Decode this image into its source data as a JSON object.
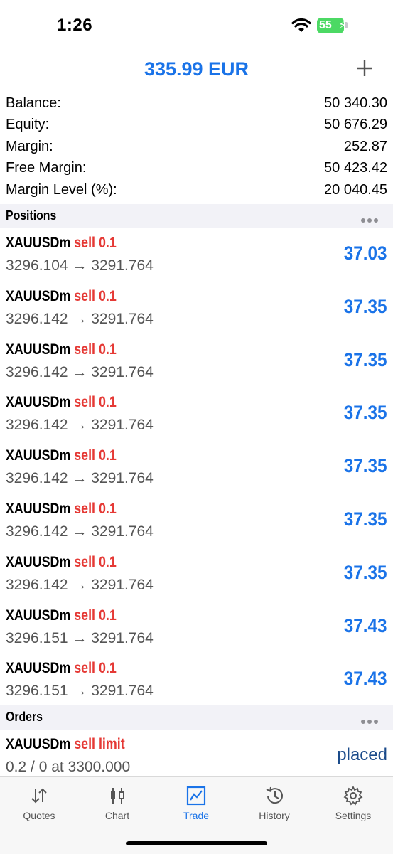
{
  "status_bar": {
    "time": "1:26",
    "battery": "55"
  },
  "header": {
    "title": "335.99 EUR"
  },
  "summary": [
    {
      "label": "Balance:",
      "value": "50 340.30"
    },
    {
      "label": "Equity:",
      "value": "50 676.29"
    },
    {
      "label": "Margin:",
      "value": "252.87"
    },
    {
      "label": "Free Margin:",
      "value": "50 423.42"
    },
    {
      "label": "Margin Level (%):",
      "value": "20 040.45"
    }
  ],
  "positions": {
    "title": "Positions",
    "items": [
      {
        "symbol": "XAUUSDm",
        "type": "sell 0.1",
        "prices": "3296.104 → 3291.764",
        "profit": "37.03"
      },
      {
        "symbol": "XAUUSDm",
        "type": "sell 0.1",
        "prices": "3296.142 → 3291.764",
        "profit": "37.35"
      },
      {
        "symbol": "XAUUSDm",
        "type": "sell 0.1",
        "prices": "3296.142 → 3291.764",
        "profit": "37.35"
      },
      {
        "symbol": "XAUUSDm",
        "type": "sell 0.1",
        "prices": "3296.142 → 3291.764",
        "profit": "37.35"
      },
      {
        "symbol": "XAUUSDm",
        "type": "sell 0.1",
        "prices": "3296.142 → 3291.764",
        "profit": "37.35"
      },
      {
        "symbol": "XAUUSDm",
        "type": "sell 0.1",
        "prices": "3296.142 → 3291.764",
        "profit": "37.35"
      },
      {
        "symbol": "XAUUSDm",
        "type": "sell 0.1",
        "prices": "3296.142 → 3291.764",
        "profit": "37.35"
      },
      {
        "symbol": "XAUUSDm",
        "type": "sell 0.1",
        "prices": "3296.151 → 3291.764",
        "profit": "37.43"
      },
      {
        "symbol": "XAUUSDm",
        "type": "sell 0.1",
        "prices": "3296.151 → 3291.764",
        "profit": "37.43"
      }
    ]
  },
  "orders": {
    "title": "Orders",
    "items": [
      {
        "symbol": "XAUUSDm",
        "type": "sell limit",
        "details": "0.2 / 0 at 3300.000",
        "status": "placed"
      }
    ]
  },
  "tabs": [
    {
      "label": "Quotes",
      "icon": "quotes-icon",
      "active": false
    },
    {
      "label": "Chart",
      "icon": "chart-icon",
      "active": false
    },
    {
      "label": "Trade",
      "icon": "trade-icon",
      "active": true
    },
    {
      "label": "History",
      "icon": "history-icon",
      "active": false
    },
    {
      "label": "Settings",
      "icon": "settings-icon",
      "active": false
    }
  ],
  "colors": {
    "accent": "#1a73e8",
    "sell": "#e53935",
    "placed": "#1a4a8a"
  }
}
